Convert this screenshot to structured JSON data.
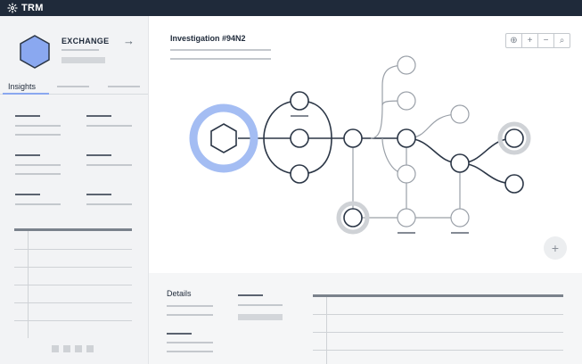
{
  "app": {
    "brand": "TRM",
    "brand_icon": "trm-logo-icon"
  },
  "sidebar": {
    "entity_label": "EXCHANGE",
    "entity_icon": "hexagon-icon",
    "open_icon": "arrow-right-icon",
    "tabs": [
      {
        "label": "Insights",
        "active": true
      }
    ],
    "pager_icon": "page-dot-icon"
  },
  "main": {
    "title": "Investigation #94N2",
    "toolbar": [
      {
        "icon": "crosshair-icon",
        "glyph": "⊕"
      },
      {
        "icon": "zoom-in-icon",
        "glyph": "+"
      },
      {
        "icon": "zoom-out-icon",
        "glyph": "−"
      },
      {
        "icon": "search-icon",
        "glyph": "⌕"
      }
    ],
    "add_icon": "plus-icon",
    "add_glyph": "+"
  },
  "details": {
    "title": "Details"
  },
  "colors": {
    "topbar": "#1f2a3a",
    "accent": "#8aa8f0",
    "node_stroke": "#2b3646",
    "muted": "#c4c8cd"
  }
}
